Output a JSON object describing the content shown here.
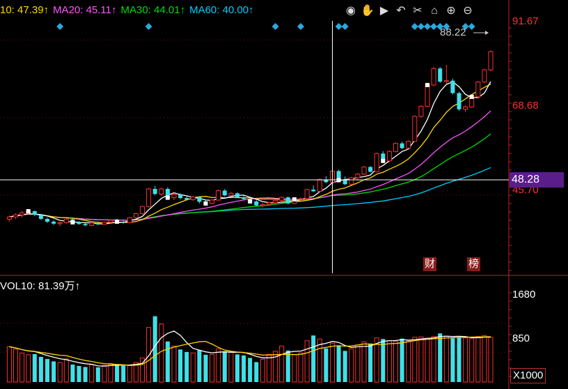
{
  "legend": {
    "ma10": "10: 47.39↑",
    "ma20": "MA20: 45.11↑",
    "ma30": "MA30: 44.01↑",
    "ma60": "MA60: 40.00↑",
    "colors": {
      "ma10": "#ffd700",
      "ma20": "#ff55ff",
      "ma30": "#00dd00",
      "ma60": "#00ccff"
    }
  },
  "toolbar": {
    "icons": [
      "eye-icon",
      "hand-icon",
      "play-icon",
      "undo-icon",
      "scissors-icon",
      "lock-icon",
      "zoom-in-icon",
      "zoom-out-icon"
    ],
    "glyphs": [
      "◉",
      "✋",
      "▶",
      "↶",
      "✂",
      "⌂",
      "⊕",
      "⊖"
    ]
  },
  "price_axis": {
    "labels": [
      "91.67",
      "68.68",
      "45.70"
    ],
    "current": "48.28",
    "high_label": "88.22"
  },
  "volume_axis": {
    "labels": [
      "1680",
      "850"
    ],
    "unit": "X1000"
  },
  "volume_legend": "VOL10: 81.39万↑",
  "badges": [
    "财",
    "榜"
  ],
  "chart_data": {
    "type": "candlestick",
    "price_range": [
      22.5,
      97.3
    ],
    "volume_range": [
      0,
      2550
    ],
    "candles": [
      [
        38.5,
        39.6,
        37.8,
        39.2
      ],
      [
        39.2,
        40.3,
        38.6,
        39.8
      ],
      [
        39.8,
        41.0,
        39.0,
        40.4
      ],
      [
        40.4,
        41.5,
        39.9,
        40.9
      ],
      [
        40.9,
        41.1,
        39.5,
        39.8
      ],
      [
        39.8,
        40.0,
        38.3,
        38.6
      ],
      [
        38.6,
        39.0,
        37.4,
        37.8
      ],
      [
        37.8,
        38.3,
        36.8,
        37.2
      ],
      [
        37.2,
        37.8,
        36.5,
        37.5
      ],
      [
        37.5,
        38.8,
        37.2,
        38.5
      ],
      [
        38.5,
        38.9,
        37.4,
        37.6
      ],
      [
        37.6,
        38.0,
        36.9,
        37.1
      ],
      [
        37.1,
        37.4,
        36.5,
        36.7
      ],
      [
        36.7,
        37.6,
        36.4,
        37.4
      ],
      [
        37.4,
        37.9,
        36.8,
        37.0
      ],
      [
        37.0,
        37.8,
        36.9,
        37.6
      ],
      [
        37.6,
        38.4,
        37.2,
        38.2
      ],
      [
        38.2,
        38.6,
        37.5,
        37.8
      ],
      [
        37.8,
        38.2,
        37.2,
        37.5
      ],
      [
        37.5,
        39.2,
        37.3,
        39.0
      ],
      [
        39.0,
        40.5,
        38.8,
        40.2
      ],
      [
        40.2,
        42.5,
        40.0,
        42.3
      ],
      [
        42.3,
        47.8,
        42.0,
        47.5
      ],
      [
        47.5,
        48.4,
        45.6,
        46.0
      ],
      [
        46.0,
        47.9,
        45.5,
        47.5
      ],
      [
        47.5,
        48.0,
        44.5,
        44.9
      ],
      [
        44.9,
        46.2,
        44.2,
        45.8
      ],
      [
        45.8,
        46.2,
        44.4,
        44.8
      ],
      [
        44.8,
        45.6,
        44.1,
        44.3
      ],
      [
        44.3,
        45.4,
        44.0,
        45.1
      ],
      [
        45.1,
        45.3,
        43.2,
        43.7
      ],
      [
        43.7,
        44.2,
        42.8,
        43.2
      ],
      [
        43.2,
        44.5,
        43.0,
        44.2
      ],
      [
        44.2,
        47.3,
        44.0,
        47.0
      ],
      [
        47.0,
        47.5,
        45.3,
        45.6
      ],
      [
        45.6,
        46.6,
        45.2,
        46.2
      ],
      [
        46.2,
        46.5,
        44.8,
        45.0
      ],
      [
        45.0,
        45.6,
        44.2,
        44.5
      ],
      [
        44.5,
        44.9,
        43.4,
        43.8
      ],
      [
        43.8,
        44.1,
        42.4,
        42.6
      ],
      [
        42.6,
        43.3,
        42.0,
        42.9
      ],
      [
        42.9,
        43.6,
        42.5,
        43.4
      ],
      [
        43.4,
        44.3,
        43.1,
        44.1
      ],
      [
        44.1,
        45.3,
        43.8,
        45.0
      ],
      [
        45.0,
        45.3,
        42.9,
        43.2
      ],
      [
        43.2,
        44.6,
        43.0,
        44.4
      ],
      [
        44.4,
        45.0,
        43.8,
        44.6
      ],
      [
        44.6,
        47.5,
        44.4,
        47.3
      ],
      [
        47.3,
        48.5,
        46.6,
        46.8
      ],
      [
        46.8,
        50.6,
        46.5,
        50.3
      ],
      [
        50.3,
        51.3,
        49.2,
        49.5
      ],
      [
        49.5,
        53.1,
        49.3,
        52.8
      ],
      [
        52.8,
        53.2,
        49.8,
        50.1
      ],
      [
        50.1,
        51.2,
        48.6,
        48.9
      ],
      [
        48.9,
        51.1,
        48.7,
        50.8
      ],
      [
        50.8,
        52.2,
        50.0,
        51.9
      ],
      [
        51.9,
        54.3,
        51.6,
        54.0
      ],
      [
        54.0,
        54.3,
        52.3,
        52.6
      ],
      [
        52.6,
        58.3,
        52.4,
        58.0
      ],
      [
        58.0,
        58.7,
        55.5,
        55.8
      ],
      [
        55.8,
        59.0,
        55.4,
        58.6
      ],
      [
        58.6,
        61.3,
        58.3,
        61.0
      ],
      [
        61.0,
        61.5,
        59.3,
        59.6
      ],
      [
        59.6,
        61.9,
        59.4,
        61.6
      ],
      [
        61.6,
        69.3,
        61.4,
        69.0
      ],
      [
        69.0,
        72.3,
        68.6,
        72.0
      ],
      [
        72.0,
        78.6,
        71.7,
        78.3
      ],
      [
        78.3,
        83.6,
        77.9,
        83.2
      ],
      [
        83.2,
        83.6,
        78.9,
        79.3
      ],
      [
        79.3,
        84.3,
        78.8,
        79.6
      ],
      [
        79.6,
        80.2,
        75.5,
        75.9
      ],
      [
        75.9,
        76.3,
        70.7,
        71.1
      ],
      [
        71.1,
        72.3,
        70.3,
        71.8
      ],
      [
        71.8,
        75.1,
        71.5,
        74.8
      ],
      [
        74.8,
        79.5,
        74.4,
        79.2
      ],
      [
        79.2,
        83.1,
        78.8,
        82.8
      ],
      [
        82.8,
        88.6,
        82.4,
        88.2
      ]
    ],
    "volumes": [
      1010,
      940,
      830,
      780,
      800,
      720,
      660,
      590,
      560,
      660,
      500,
      460,
      430,
      490,
      420,
      480,
      530,
      500,
      460,
      470,
      560,
      690,
      1560,
      1880,
      1660,
      1160,
      1030,
      930,
      860,
      830,
      910,
      780,
      790,
      950,
      880,
      850,
      790,
      760,
      690,
      570,
      650,
      790,
      880,
      1030,
      900,
      780,
      830,
      1180,
      1330,
      1230,
      960,
      1110,
      1030,
      890,
      950,
      1060,
      1150,
      1100,
      1260,
      1230,
      1180,
      1160,
      1240,
      1180,
      1280,
      1290,
      1250,
      1300,
      1390,
      1310,
      1250,
      1280,
      1260,
      1240,
      1300,
      1330,
      1280
    ]
  }
}
